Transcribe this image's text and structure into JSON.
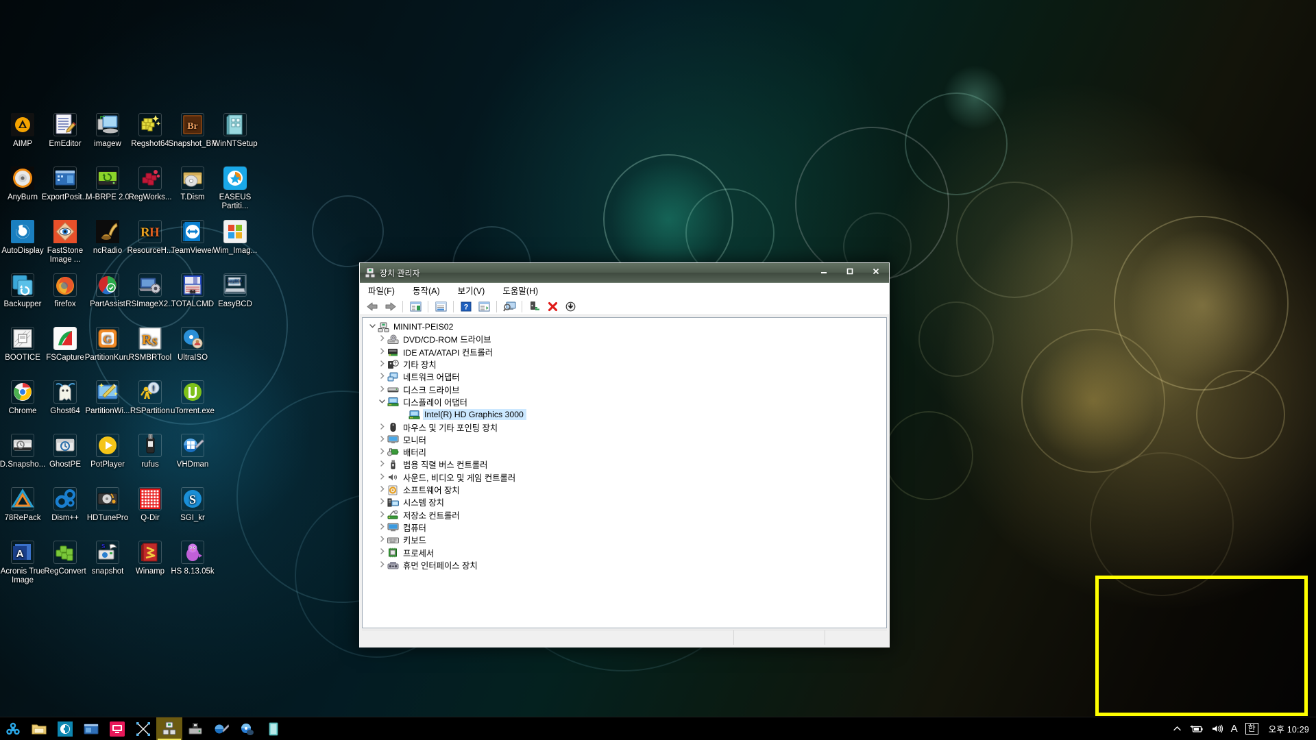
{
  "desktop": {
    "icons": [
      {
        "label": "AIMP",
        "icon": "aimp-icon",
        "row": 0,
        "col": 0
      },
      {
        "label": "EmEditor",
        "icon": "emeditor-icon",
        "row": 0,
        "col": 1
      },
      {
        "label": "imagew",
        "icon": "imagew-icon",
        "row": 0,
        "col": 2
      },
      {
        "label": "Regshot64",
        "icon": "regshot64-icon",
        "row": 0,
        "col": 3
      },
      {
        "label": "Snapshot_BR",
        "icon": "snapshot-br-icon",
        "row": 0,
        "col": 4
      },
      {
        "label": "WinNTSetup",
        "icon": "winntsetup-icon",
        "row": 0,
        "col": 5
      },
      {
        "label": "AnyBurn",
        "icon": "anyburn-icon",
        "row": 1,
        "col": 0
      },
      {
        "label": "ExportPosit...",
        "icon": "exportposition-icon",
        "row": 1,
        "col": 1
      },
      {
        "label": "M-BRPE 2.0",
        "icon": "m-brpe-icon",
        "row": 1,
        "col": 2
      },
      {
        "label": "RegWorks...",
        "icon": "regworks-icon",
        "row": 1,
        "col": 3
      },
      {
        "label": "T.Dism",
        "icon": "tdism-icon",
        "row": 1,
        "col": 4
      },
      {
        "label": "EASEUS Partiti...",
        "icon": "easeus-partition-icon",
        "row": 1,
        "col": 5
      },
      {
        "label": "AutoDisplay",
        "icon": "autodisplay-icon",
        "row": 2,
        "col": 0
      },
      {
        "label": "FastStone Image ...",
        "icon": "faststone-image-icon",
        "row": 2,
        "col": 1
      },
      {
        "label": "ncRadio",
        "icon": "ncradio-icon",
        "row": 2,
        "col": 2
      },
      {
        "label": "ResourceH...",
        "icon": "resourcehacker-icon",
        "row": 2,
        "col": 3
      },
      {
        "label": "TeamViewer",
        "icon": "teamviewer-icon",
        "row": 2,
        "col": 4
      },
      {
        "label": "Wim_Imag...",
        "icon": "wim-imager-icon",
        "row": 2,
        "col": 5
      },
      {
        "label": "Backupper",
        "icon": "backupper-icon",
        "row": 3,
        "col": 0
      },
      {
        "label": "firefox",
        "icon": "firefox-icon",
        "row": 3,
        "col": 1
      },
      {
        "label": "PartAssist",
        "icon": "partassist-icon",
        "row": 3,
        "col": 2
      },
      {
        "label": "RSImageX2...",
        "icon": "rsimagex2-icon",
        "row": 3,
        "col": 3
      },
      {
        "label": "TOTALCMD",
        "icon": "totalcmd-icon",
        "row": 3,
        "col": 4
      },
      {
        "label": "EasyBCD",
        "icon": "easybcd-icon",
        "row": 3,
        "col": 5
      },
      {
        "label": "BOOTICE",
        "icon": "bootice-icon",
        "row": 4,
        "col": 0
      },
      {
        "label": "FSCapture",
        "icon": "fscapture-icon",
        "row": 4,
        "col": 1
      },
      {
        "label": "PartitionKuru",
        "icon": "partitionkuru-icon",
        "row": 4,
        "col": 2
      },
      {
        "label": "RSMBRTool",
        "icon": "rsmbrtool-icon",
        "row": 4,
        "col": 3
      },
      {
        "label": "UltraISO",
        "icon": "ultraiso-icon",
        "row": 4,
        "col": 4
      },
      {
        "label": "Chrome",
        "icon": "chrome-icon",
        "row": 5,
        "col": 0
      },
      {
        "label": "Ghost64",
        "icon": "ghost64-icon",
        "row": 5,
        "col": 1
      },
      {
        "label": "PartitionWi...",
        "icon": "partitionwizard-icon",
        "row": 5,
        "col": 2
      },
      {
        "label": "RSPartition",
        "icon": "rspartition-icon",
        "row": 5,
        "col": 3
      },
      {
        "label": "uTorrent.exe",
        "icon": "utorrent-icon",
        "row": 5,
        "col": 4
      },
      {
        "label": "D.Snapsho...",
        "icon": "drive-snapshot-icon",
        "row": 6,
        "col": 0
      },
      {
        "label": "GhostPE",
        "icon": "ghostpe-icon",
        "row": 6,
        "col": 1
      },
      {
        "label": "PotPlayer",
        "icon": "potplayer-icon",
        "row": 6,
        "col": 2
      },
      {
        "label": "rufus",
        "icon": "rufus-icon",
        "row": 6,
        "col": 3
      },
      {
        "label": "VHDman",
        "icon": "vhdman-icon",
        "row": 6,
        "col": 4
      },
      {
        "label": "78RePack",
        "icon": "78repack-icon",
        "row": 7,
        "col": 0
      },
      {
        "label": "Dism++",
        "icon": "dismpp-icon",
        "row": 7,
        "col": 1
      },
      {
        "label": "HDTunePro",
        "icon": "hdtunepro-icon",
        "row": 7,
        "col": 2
      },
      {
        "label": "Q-Dir",
        "icon": "qdir-icon",
        "row": 7,
        "col": 3
      },
      {
        "label": "SGI_kr",
        "icon": "sgi-kr-icon",
        "row": 7,
        "col": 4
      },
      {
        "label": "Acronis True Image",
        "icon": "acronis-true-image-icon",
        "row": 8,
        "col": 0
      },
      {
        "label": "RegConvert",
        "icon": "regconvert-icon",
        "row": 8,
        "col": 1
      },
      {
        "label": "snapshot",
        "icon": "snapshot-icon",
        "row": 8,
        "col": 2
      },
      {
        "label": "Winamp",
        "icon": "winamp-icon",
        "row": 8,
        "col": 3
      },
      {
        "label": "HS 8.13.05k",
        "icon": "hs-icon",
        "row": 8,
        "col": 4
      }
    ]
  },
  "window": {
    "title": "장치 관리자",
    "title_icon": "device-manager-icon",
    "controls": {
      "minimize": "–",
      "maximize": "☐",
      "close": "✕"
    },
    "menu": [
      {
        "label": "파일(F)",
        "name": "menu-file"
      },
      {
        "label": "동작(A)",
        "name": "menu-action"
      },
      {
        "label": "보기(V)",
        "name": "menu-view"
      },
      {
        "label": "도움말(H)",
        "name": "menu-help"
      }
    ],
    "toolbar": [
      {
        "name": "back-button",
        "icon": "back-arrow-icon"
      },
      {
        "name": "forward-button",
        "icon": "forward-arrow-icon"
      },
      {
        "name": "separator-1",
        "icon": "separator"
      },
      {
        "name": "show-hide-console-tree-button",
        "icon": "console-tree-icon"
      },
      {
        "name": "separator-2",
        "icon": "separator"
      },
      {
        "name": "properties-button",
        "icon": "properties-icon"
      },
      {
        "name": "separator-3",
        "icon": "separator"
      },
      {
        "name": "help-button",
        "icon": "help-question-icon"
      },
      {
        "name": "show-details-button",
        "icon": "details-pane-icon"
      },
      {
        "name": "separator-4",
        "icon": "separator"
      },
      {
        "name": "scan-for-hardware-changes-button",
        "icon": "scan-monitor-icon"
      },
      {
        "name": "separator-5",
        "icon": "separator"
      },
      {
        "name": "update-driver-button",
        "icon": "update-driver-icon"
      },
      {
        "name": "uninstall-device-button",
        "icon": "red-x-icon"
      },
      {
        "name": "disable-device-button",
        "icon": "down-arrow-circle-icon"
      }
    ],
    "tree": [
      {
        "label": "MININT-PEIS02",
        "depth": 0,
        "expanded": true,
        "icon": "computer-root-icon",
        "selected": false
      },
      {
        "label": "DVD/CD-ROM 드라이브",
        "depth": 1,
        "expanded": false,
        "icon": "dvd-drive-icon",
        "selected": false
      },
      {
        "label": "IDE ATA/ATAPI 컨트롤러",
        "depth": 1,
        "expanded": false,
        "icon": "ide-controller-icon",
        "selected": false
      },
      {
        "label": "기타 장치",
        "depth": 1,
        "expanded": false,
        "icon": "other-device-icon",
        "selected": false
      },
      {
        "label": "네트워크 어댑터",
        "depth": 1,
        "expanded": false,
        "icon": "network-adapter-icon",
        "selected": false
      },
      {
        "label": "디스크 드라이브",
        "depth": 1,
        "expanded": false,
        "icon": "disk-drive-icon",
        "selected": false
      },
      {
        "label": "디스플레이 어댑터",
        "depth": 1,
        "expanded": true,
        "icon": "display-adapter-icon",
        "selected": false
      },
      {
        "label": "Intel(R) HD Graphics 3000",
        "depth": 2,
        "expanded": null,
        "icon": "display-adapter-icon",
        "selected": true
      },
      {
        "label": "마우스 및 기타 포인팅 장치",
        "depth": 1,
        "expanded": false,
        "icon": "mouse-icon",
        "selected": false
      },
      {
        "label": "모니터",
        "depth": 1,
        "expanded": false,
        "icon": "monitor-icon",
        "selected": false
      },
      {
        "label": "배터리",
        "depth": 1,
        "expanded": false,
        "icon": "battery-icon",
        "selected": false
      },
      {
        "label": "범용 직렬 버스 컨트롤러",
        "depth": 1,
        "expanded": false,
        "icon": "usb-controller-icon",
        "selected": false
      },
      {
        "label": "사운드, 비디오 및 게임 컨트롤러",
        "depth": 1,
        "expanded": false,
        "icon": "sound-icon",
        "selected": false
      },
      {
        "label": "소프트웨어 장치",
        "depth": 1,
        "expanded": false,
        "icon": "software-device-icon",
        "selected": false
      },
      {
        "label": "시스템 장치",
        "depth": 1,
        "expanded": false,
        "icon": "system-device-icon",
        "selected": false
      },
      {
        "label": "저장소 컨트롤러",
        "depth": 1,
        "expanded": false,
        "icon": "storage-controller-icon",
        "selected": false
      },
      {
        "label": "컴퓨터",
        "depth": 1,
        "expanded": false,
        "icon": "computer-icon",
        "selected": false
      },
      {
        "label": "키보드",
        "depth": 1,
        "expanded": false,
        "icon": "keyboard-icon",
        "selected": false
      },
      {
        "label": "프로세서",
        "depth": 1,
        "expanded": false,
        "icon": "processor-icon",
        "selected": false
      },
      {
        "label": "휴먼 인터페이스 장치",
        "depth": 1,
        "expanded": false,
        "icon": "hid-icon",
        "selected": false
      }
    ],
    "statusbar": {
      "pane1": "",
      "pane2": "",
      "pane3": ""
    }
  },
  "taskbar": {
    "buttons": [
      {
        "name": "taskbar-biohazard",
        "icon": "biohazard-icon",
        "active": false
      },
      {
        "name": "taskbar-explorer",
        "icon": "folder-icon",
        "active": false
      },
      {
        "name": "taskbar-disc-tool",
        "icon": "teal-disc-icon",
        "active": false
      },
      {
        "name": "taskbar-blue-window",
        "icon": "blue-window-icon",
        "active": false
      },
      {
        "name": "taskbar-pink-monitor",
        "icon": "pink-monitor-icon",
        "active": false
      },
      {
        "name": "taskbar-selection-tool",
        "icon": "selection-handles-icon",
        "active": false
      },
      {
        "name": "taskbar-device-manager",
        "icon": "device-manager-icon",
        "active": true
      },
      {
        "name": "taskbar-gray-device",
        "icon": "gray-device-icon",
        "active": false
      },
      {
        "name": "taskbar-blue-tool",
        "icon": "blue-tool-icon",
        "active": false
      },
      {
        "name": "taskbar-blue-disc",
        "icon": "blue-disc-icon",
        "active": false
      },
      {
        "name": "taskbar-cyan-doc",
        "icon": "cyan-document-icon",
        "active": false
      }
    ],
    "tray": [
      {
        "name": "tray-show-hidden-icons",
        "glyph": "∧",
        "icon": "chevron-up-icon"
      },
      {
        "name": "tray-battery",
        "glyph": "",
        "icon": "battery-plug-icon"
      },
      {
        "name": "tray-volume",
        "glyph": "",
        "icon": "volume-icon"
      },
      {
        "name": "tray-ime-alpha",
        "glyph": "A",
        "icon": "ime-alpha-icon"
      },
      {
        "name": "tray-ime-korean",
        "glyph": "한",
        "icon": "ime-korean-icon"
      }
    ],
    "clock": "오후 10:29"
  },
  "annotation": {
    "color": "#ffff00",
    "label": ""
  },
  "colors": {
    "selection": "#cce8ff",
    "annotation": "#ffff00",
    "window_chrome": "#f0f0f0",
    "taskbar_active": "#6b5a10"
  }
}
